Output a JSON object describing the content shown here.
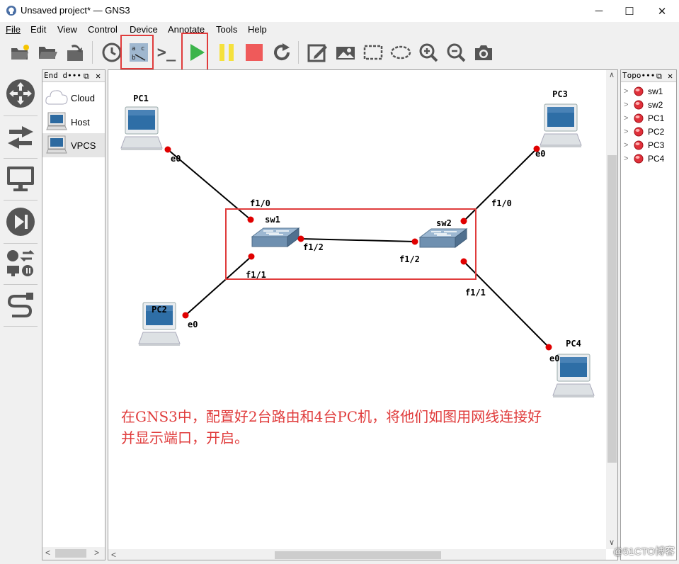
{
  "window": {
    "title": "Unsaved project* — GNS3",
    "minimize": "─",
    "maximize": "☐",
    "close": "✕"
  },
  "menu": [
    "File",
    "Edit",
    "View",
    "Control",
    "Device",
    "Annotate",
    "Tools",
    "Help"
  ],
  "toolbar": {
    "items": [
      "new-project",
      "open-project",
      "save-project",
      "snapshot-clock",
      "show-interface-labels",
      "console-all",
      "start-all",
      "suspend-all",
      "stop-all",
      "reload-all",
      "add-note",
      "insert-image",
      "draw-rectangle",
      "draw-ellipse",
      "zoom-in",
      "zoom-out",
      "screenshot"
    ],
    "console_glyph": ">_"
  },
  "left_toolbar": [
    "browse-routers",
    "browse-switches",
    "browse-end-devices",
    "browse-security-devices",
    "browse-all-devices",
    "add-link"
  ],
  "devices_panel": {
    "title": "End d∙∙∙",
    "items": [
      {
        "label": "Cloud",
        "icon": "cloud-icon"
      },
      {
        "label": "Host",
        "icon": "host-icon"
      },
      {
        "label": "VPCS",
        "icon": "vpcs-icon",
        "selected": true
      }
    ]
  },
  "topology_panel": {
    "title": "Topo∙∙∙",
    "items": [
      "sw1",
      "sw2",
      "PC1",
      "PC2",
      "PC3",
      "PC4"
    ],
    "status_color": "#e0303a"
  },
  "canvas": {
    "nodes": [
      {
        "id": "PC1",
        "label": "PC1",
        "type": "pc"
      },
      {
        "id": "PC2",
        "label": "PC2",
        "type": "pc"
      },
      {
        "id": "PC3",
        "label": "PC3",
        "type": "pc"
      },
      {
        "id": "PC4",
        "label": "PC4",
        "type": "pc"
      },
      {
        "id": "sw1",
        "label": "sw1",
        "type": "switch"
      },
      {
        "id": "sw2",
        "label": "sw2",
        "type": "switch"
      }
    ],
    "links": [
      {
        "a": "PC1",
        "a_port": "e0",
        "b": "sw1",
        "b_port": "f1/0"
      },
      {
        "a": "sw1",
        "a_port": "f1/1",
        "b": "PC2",
        "b_port": "e0"
      },
      {
        "a": "sw1",
        "a_port": "f1/2",
        "b": "sw2",
        "b_port": "f1/2"
      },
      {
        "a": "PC3",
        "a_port": "e0",
        "b": "sw2",
        "b_port": "f1/0"
      },
      {
        "a": "sw2",
        "a_port": "f1/1",
        "b": "PC4",
        "b_port": "e0"
      }
    ],
    "note_lines": [
      "在GNS3中，配置好2台路由和4台PC机，将他们如图用网线连接好",
      "并显示端口，开启。"
    ],
    "highlight_color": "#e03c3c",
    "port_color": "#e00000"
  },
  "watermark": "@51CTO博客"
}
